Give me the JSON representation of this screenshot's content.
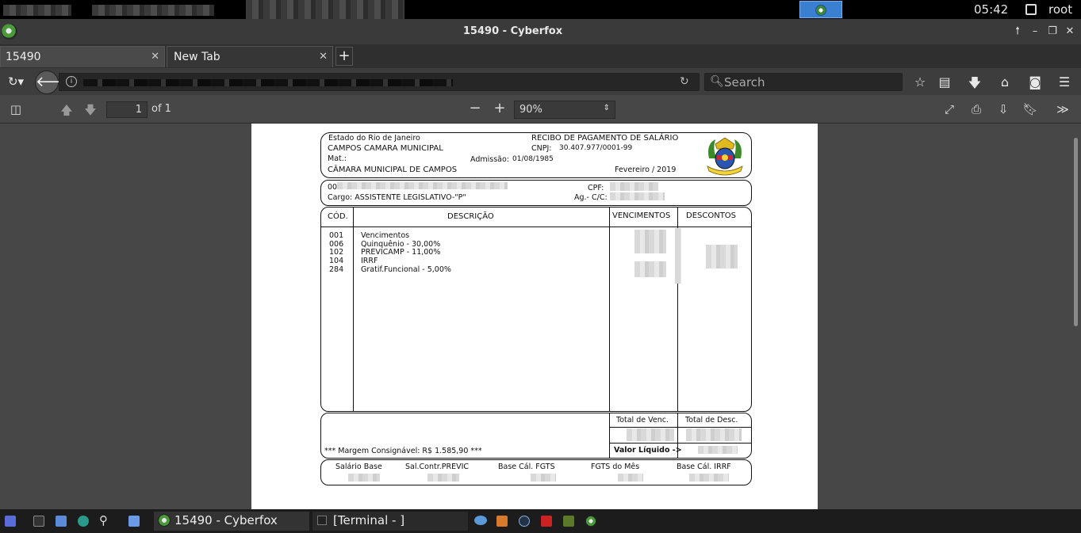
{
  "system": {
    "clock": "05:42",
    "user": "root"
  },
  "window": {
    "title": "15490 - Cyberfox"
  },
  "tabs": [
    {
      "label": "15490"
    },
    {
      "label": "New Tab"
    }
  ],
  "nav": {
    "search_placeholder": "Search"
  },
  "pdf_toolbar": {
    "page_value": "1",
    "page_of": "of 1",
    "zoom": "90%"
  },
  "doc": {
    "header": {
      "state": "Estado do Rio de Janeiro",
      "org": "CAMPOS CAMARA MUNICIPAL",
      "mat_label": "Mat.:",
      "dept": "CÂMARA MUNICIPAL DE CAMPOS",
      "receipt_title": "RECIBO DE PAGAMENTO DE SALÁRIO",
      "cnpj_label": "CNPJ:",
      "cnpj": "30.407.977/0001-99",
      "admissao_label": "Admissão:",
      "admissao": "01/08/1985",
      "period": "Fevereiro / 2019"
    },
    "employee": {
      "code_prefix": "00",
      "cargo": "Cargo: ASSISTENTE LEGISLATIVO-\"P\"",
      "cpf_label": "CPF:",
      "agcc_label": "Ag.- C/C:"
    },
    "table": {
      "headers": {
        "cod": "CÓD.",
        "desc": "DESCRIÇÃO",
        "venc": "VENCIMENTOS",
        "descontos": "DESCONTOS"
      },
      "rows": [
        {
          "cod": "001",
          "desc": "Vencimentos"
        },
        {
          "cod": "006",
          "desc": "Quinquênio - 30,00%"
        },
        {
          "cod": "102",
          "desc": "PREVICAMP - 11,00%"
        },
        {
          "cod": "104",
          "desc": "IRRF"
        },
        {
          "cod": "284",
          "desc": "Gratif.Funcional - 5,00%"
        }
      ]
    },
    "totals": {
      "margem": "*** Margem Consignável: R$ 1.585,90 ***",
      "total_venc": "Total de Venc.",
      "total_desc": "Total de Desc.",
      "valor_liquido": "Valor Líquido ->"
    },
    "footer": {
      "salario_base": "Salário Base",
      "sal_contr": "Sal.Contr.PREVIC",
      "base_fgts": "Base Cál. FGTS",
      "fgts_mes": "FGTS do Mês",
      "base_irrf": "Base Cál. IRRF"
    }
  },
  "taskbar": {
    "apps": [
      {
        "label": "15490 - Cyberfox"
      },
      {
        "label": "[Terminal - ]"
      }
    ]
  }
}
